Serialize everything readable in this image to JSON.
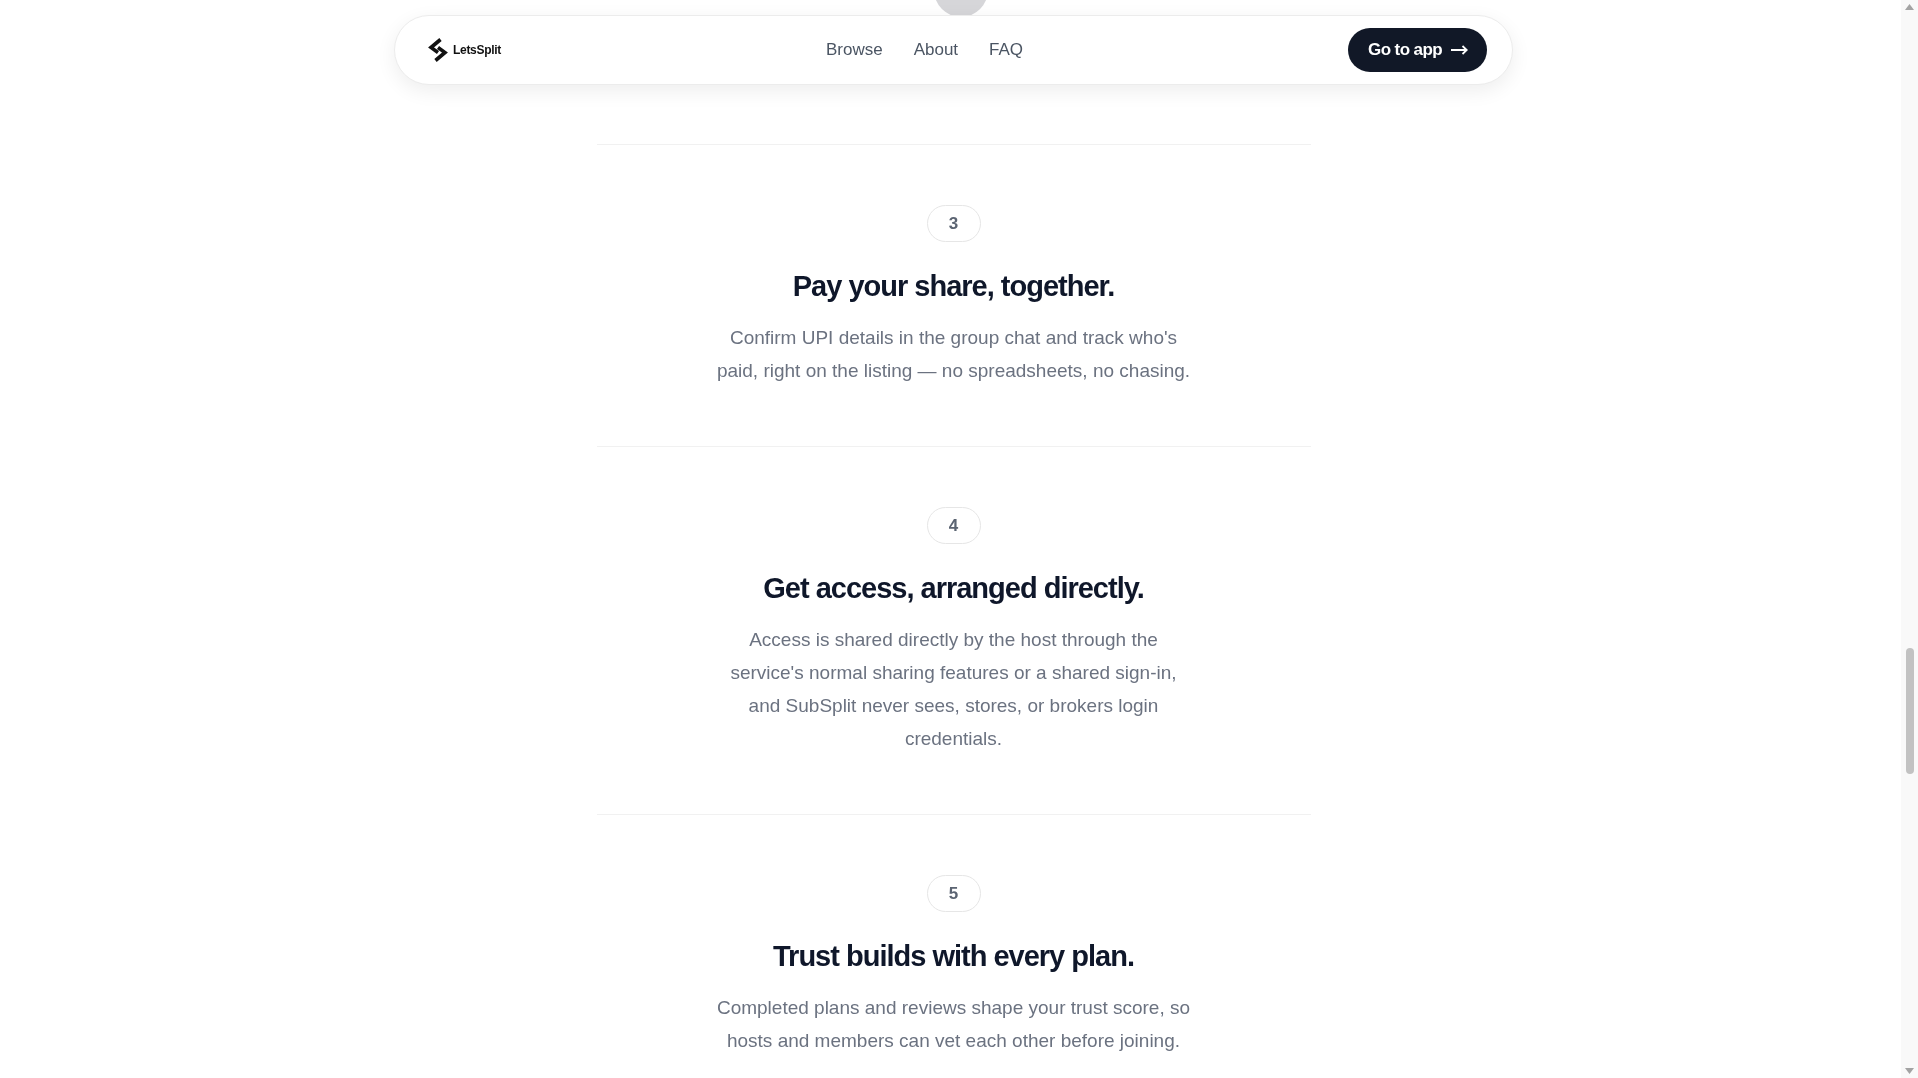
{
  "header": {
    "logo": "LetsSplit",
    "nav": [
      "Browse",
      "About",
      "FAQ"
    ],
    "cta": "Go to app"
  },
  "steps": [
    {
      "number": "3",
      "title": "Pay your share, together.",
      "description": "Confirm UPI details in the group chat and track who's paid, right on the listing — no spreadsheets, no chasing."
    },
    {
      "number": "4",
      "title": "Get access, arranged directly.",
      "description": "Access is shared directly by the host through the service's normal sharing features or a shared sign-in, and SubSplit never sees, stores, or brokers login credentials."
    },
    {
      "number": "5",
      "title": "Trust builds with every plan.",
      "description": "Completed plans and reviews shape your trust score, so hosts and members can vet each other before joining."
    }
  ]
}
